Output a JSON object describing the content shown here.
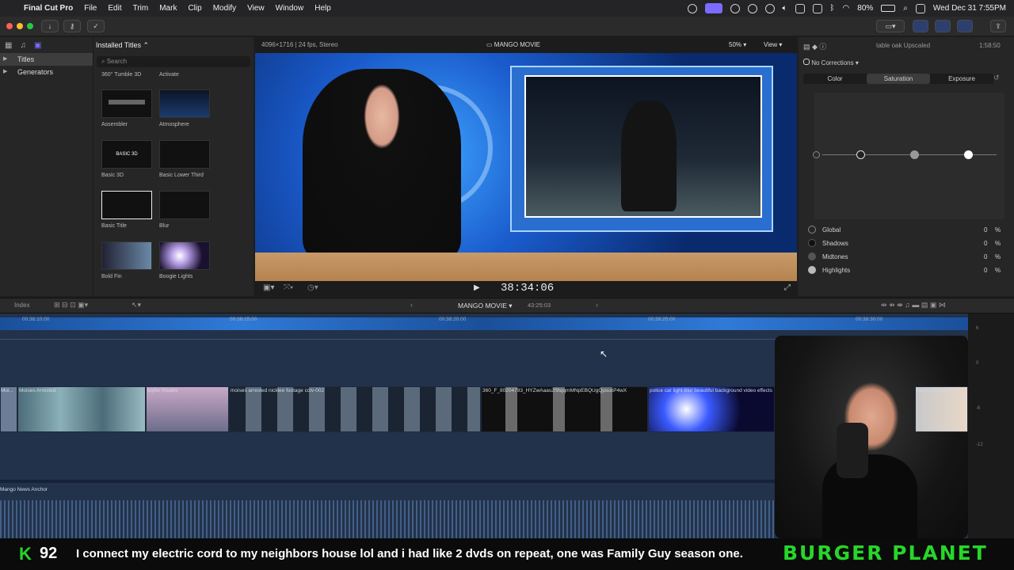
{
  "menubar": {
    "app_name": "Final Cut Pro",
    "items": [
      "File",
      "Edit",
      "Trim",
      "Mark",
      "Clip",
      "Modify",
      "View",
      "Window",
      "Help"
    ],
    "battery": "80%",
    "datetime": "Wed Dec 31  7:55PM"
  },
  "browser": {
    "sidebar": [
      "Titles",
      "Generators"
    ],
    "header": "Installed Titles",
    "search_placeholder": "Search",
    "top_labels": [
      "360° Tumble 3D",
      "Activate"
    ],
    "titles": [
      "Assembler",
      "Atmosphere",
      "Basic 3D",
      "Basic Lower Third",
      "Basic Title",
      "Blur",
      "Bold Fin",
      "Boogie Lights"
    ]
  },
  "viewer": {
    "format": "4096×1716 | 24 fps, Stereo",
    "project": "MANGO MOVIE",
    "zoom": "50%",
    "view_label": "View",
    "timecode": "38:34:06"
  },
  "inspector": {
    "clip_name": "table oak Upscaled",
    "duration": "1:58:50",
    "corrections": "No Corrections",
    "tabs": [
      "Color",
      "Saturation",
      "Exposure"
    ],
    "active_tab": "Saturation",
    "rows": [
      {
        "label": "Global",
        "value": "0",
        "unit": "%"
      },
      {
        "label": "Shadows",
        "value": "0",
        "unit": "%"
      },
      {
        "label": "Midtones",
        "value": "0",
        "unit": "%"
      },
      {
        "label": "Highlights",
        "value": "0",
        "unit": "%"
      }
    ]
  },
  "timeline": {
    "index_label": "Index",
    "project": "MANGO MOVIE",
    "duration": "43:25:03",
    "ruler": [
      "00:38:10:00",
      "00:38:15:00",
      "00:38:20:00",
      "00:38:25:00",
      "00:38:30:00"
    ],
    "clips": [
      "Moi...",
      "Moises Arrested",
      "topfer theatre",
      "moises arrested nicklee footage cctv-002",
      "360_F_80204793_HYZwAaas2f9tqqmMNpEBQUgQpsuxP4wX",
      "police car light-blur beautiful background video effects",
      "heavy Mugshot E..."
    ],
    "audio_clip": "Mango News Anchor",
    "meter_ticks": [
      "6",
      "0",
      "-6",
      "-12"
    ]
  },
  "ticker": {
    "badge": "K",
    "number": "92",
    "message": "I connect my electric cord to my neighbors house lol and i had like 2 dvds on repeat, one was Family Guy season one.",
    "brand": "BURGER PLANET"
  },
  "colors": {
    "accent": "#7a6cff",
    "ticker_green": "#27d629",
    "timeline_bg": "#22324a"
  }
}
